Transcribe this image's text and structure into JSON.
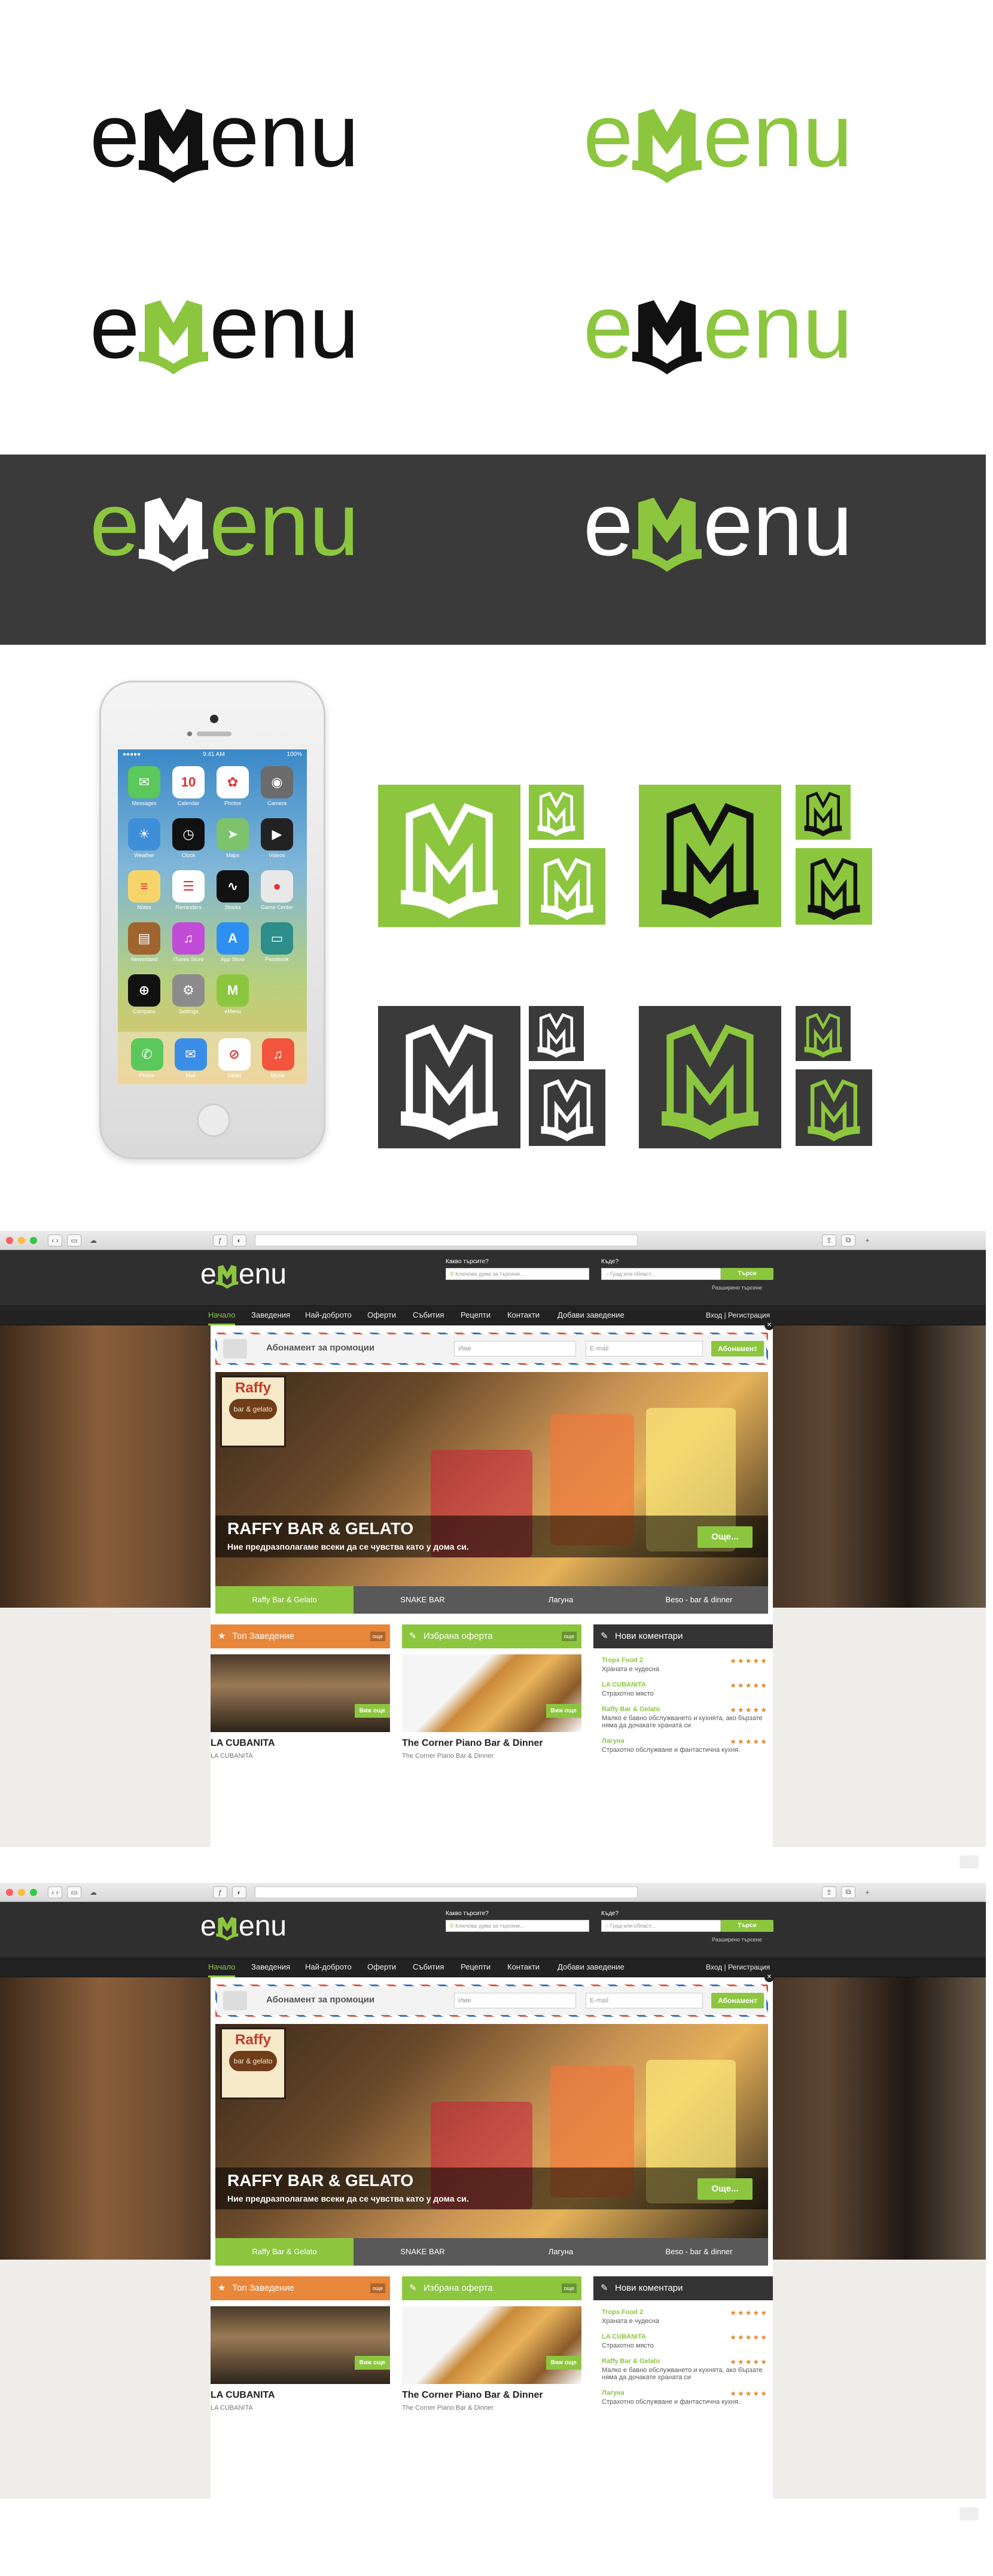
{
  "brand": {
    "green": "#8cc63f",
    "dark": "#3a3a3a",
    "black": "#111111",
    "white": "#ffffff",
    "orange": "#e8863a"
  },
  "logos": [
    {
      "text_a": "e",
      "text_b": "enu",
      "variant": "black"
    },
    {
      "text_a": "e",
      "text_b": "enu",
      "variant": "green"
    },
    {
      "text_a": "e",
      "text_b": "enu",
      "variant": "black-green-m"
    },
    {
      "text_a": "e",
      "text_b": "enu",
      "variant": "green-black-m"
    },
    {
      "text_a": "e",
      "text_b": "enu",
      "variant": "on-dark-green"
    },
    {
      "text_a": "e",
      "text_b": "enu",
      "variant": "on-dark-white"
    }
  ],
  "phone": {
    "time": "9:41 AM",
    "battery": "100%",
    "apps": [
      {
        "label": "Messages",
        "icon": "messages-icon",
        "color": "#5ac85a",
        "glyph": "✉"
      },
      {
        "label": "Calendar",
        "icon": "calendar-icon",
        "color": "#ffffff",
        "glyph": "10"
      },
      {
        "label": "Photos",
        "icon": "photos-icon",
        "color": "#ffffff",
        "glyph": "✿"
      },
      {
        "label": "Camera",
        "icon": "camera-icon",
        "color": "#6b6b6b",
        "glyph": "◉"
      },
      {
        "label": "Weather",
        "icon": "weather-icon",
        "color": "#3f8fd8",
        "glyph": "☀"
      },
      {
        "label": "Clock",
        "icon": "clock-icon",
        "color": "#111111",
        "glyph": "◷"
      },
      {
        "label": "Maps",
        "icon": "maps-icon",
        "color": "#7cc36b",
        "glyph": "➤"
      },
      {
        "label": "Videos",
        "icon": "videos-icon",
        "color": "#222222",
        "glyph": "▶"
      },
      {
        "label": "Notes",
        "icon": "notes-icon",
        "color": "#f7d46a",
        "glyph": "≡"
      },
      {
        "label": "Reminders",
        "icon": "reminders-icon",
        "color": "#ffffff",
        "glyph": "☰"
      },
      {
        "label": "Stocks",
        "icon": "stocks-icon",
        "color": "#111111",
        "glyph": "∿"
      },
      {
        "label": "Game Center",
        "icon": "game-center-icon",
        "color": "#e8e8e8",
        "glyph": "●"
      },
      {
        "label": "Newsstand",
        "icon": "newsstand-icon",
        "color": "#a0652e",
        "glyph": "▤"
      },
      {
        "label": "iTunes Store",
        "icon": "itunes-icon",
        "color": "#c04cd8",
        "glyph": "♫"
      },
      {
        "label": "App Store",
        "icon": "appstore-icon",
        "color": "#2e8ff0",
        "glyph": "A"
      },
      {
        "label": "Passbook",
        "icon": "passbook-icon",
        "color": "#2d8e8a",
        "glyph": "▭"
      },
      {
        "label": "Compass",
        "icon": "compass-icon",
        "color": "#111111",
        "glyph": "⊕"
      },
      {
        "label": "Settings",
        "icon": "settings-icon",
        "color": "#8c8c8c",
        "glyph": "⚙"
      },
      {
        "label": "eMenu",
        "icon": "emenu-app-icon",
        "color": "#8cc63f",
        "glyph": "M"
      }
    ],
    "dock": [
      {
        "label": "Phone",
        "icon": "phone-icon",
        "color": "#5ac85a",
        "glyph": "✆"
      },
      {
        "label": "Mail",
        "icon": "mail-icon",
        "color": "#3a8ee8",
        "glyph": "✉"
      },
      {
        "label": "Safari",
        "icon": "safari-icon",
        "color": "#ffffff",
        "glyph": "⊘"
      },
      {
        "label": "Music",
        "icon": "music-icon",
        "color": "#f2553b",
        "glyph": "♫"
      }
    ]
  },
  "site": {
    "logo_a": "e",
    "logo_b": "enu",
    "search_label_what": "Какво търсите?",
    "search_label_where": "Къде?",
    "search_placeholder_what": "Ключова дума за търсене...",
    "search_placeholder_where": "Град или област...",
    "search_button": "Търси",
    "advanced_search": "Разширено търсене",
    "nav": [
      "Начало",
      "Заведения",
      "Най-доброто",
      "Оферти",
      "Събития",
      "Рецепти",
      "Контакти",
      "Добави заведение"
    ],
    "login": "Вход",
    "separator": "|",
    "register": "Регистрация",
    "promo_title": "Абонамент за промоции",
    "promo_name": "Име",
    "promo_email": "E-mail",
    "promo_button": "Абонамент",
    "slider": {
      "brand_top": "Raffy",
      "brand_badge": "bar & gelato",
      "title": "RAFFY BAR & GELATO",
      "subtitle": "Ние предразполагаме всеки да се чувства като у дома си.",
      "more": "Още...",
      "tabs": [
        "Raffy Bar & Gelato",
        "SNAKE BAR",
        "Лагуна",
        "Beso - bar & dinner"
      ]
    },
    "box1": {
      "title": "Топ Заведение",
      "all": "още",
      "name": "LA CUBANITA",
      "sub": "LA CUBANITA",
      "more": "Виж още"
    },
    "box2": {
      "title": "Избрана оферта",
      "all": "още",
      "name": "The Corner Piano Bar & Dinner",
      "sub": "The Corner Piano Bar & Dinner",
      "more": "Виж още"
    },
    "box3": {
      "title": "Нови коментари",
      "stars": "★★★★★",
      "comments": [
        {
          "name": "Tropx Food 2",
          "text": "Храната е чудесна"
        },
        {
          "name": "LA CUBANITA",
          "text": "Страхотно място"
        },
        {
          "name": "Raffy Bar & Gelato",
          "text": "Малко е бавно обслужването и кухнята, ако бързате няма да дочакате храната си"
        },
        {
          "name": "Лагуна",
          "text": "Страхотно обслужване и фантастична кухня."
        }
      ]
    }
  }
}
